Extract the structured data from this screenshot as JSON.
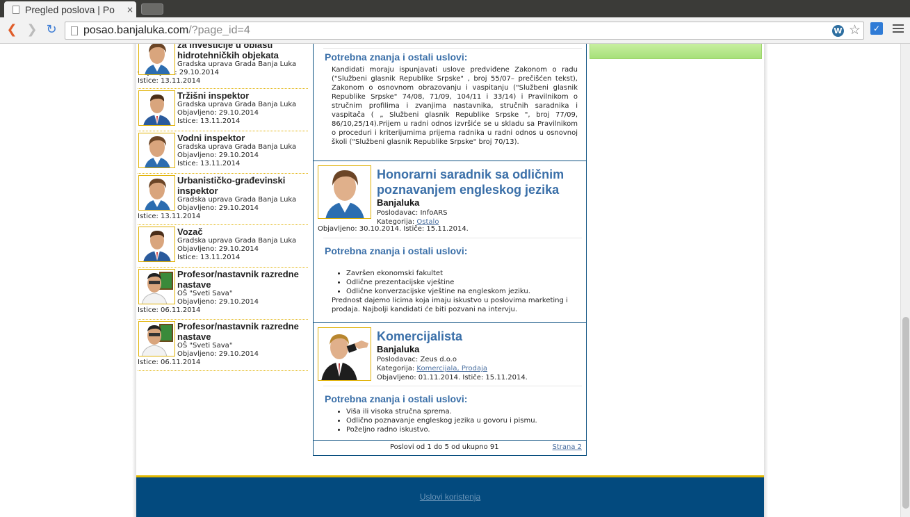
{
  "browser": {
    "tab_title": "Pregled poslova | Po",
    "tab_close": "×",
    "url_host": "posao.banjaluka.com",
    "url_path": "/?page_id=4"
  },
  "sidebar": {
    "items": [
      {
        "title": "za investicije u oblasti hidrotehničkih objekata",
        "employer": "Gradska uprava Grada Banja Luka",
        "published": "Objavljeno: 29.10.2014",
        "expires": "Istice: 13.11.2014",
        "avatar": "woman-avatar"
      },
      {
        "title": "Tržišni inspektor",
        "employer": "Gradska uprava Grada Banja Luka",
        "published": "Objavljeno: 29.10.2014",
        "expires": "Istice: 13.11.2014",
        "avatar": "man-avatar"
      },
      {
        "title": "Vodni inspektor",
        "employer": "Gradska uprava Grada Banja Luka",
        "published": "Objavljeno: 29.10.2014",
        "expires": "Istice: 13.11.2014",
        "avatar": "woman-avatar"
      },
      {
        "title": "Urbanističko-građevinski inspektor",
        "employer": "Gradska uprava Grada Banja Luka",
        "published": "Objavljeno: 29.10.2014",
        "expires": "Istice: 13.11.2014",
        "avatar": "woman-avatar"
      },
      {
        "title": "Vozač",
        "employer": "Gradska uprava Grada Banja Luka",
        "published": "Objavljeno: 29.10.2014",
        "expires": "Istice: 13.11.2014",
        "avatar": "man-avatar"
      },
      {
        "title": "Profesor/nastavnik razredne nastave",
        "employer": "OŠ \"Sveti Sava\"",
        "published": "Objavljeno: 29.10.2014",
        "expires": "Istice: 06.11.2014",
        "avatar": "teacher-avatar"
      },
      {
        "title": "Profesor/nastavnik razredne nastave",
        "employer": "OŠ \"Sveti Sava\"",
        "published": "Objavljeno: 29.10.2014",
        "expires": "Istice: 06.11.2014",
        "avatar": "teacher-avatar"
      }
    ]
  },
  "center": {
    "first_block": {
      "heading": "Potrebna znanja i ostali uslovi:",
      "text": "Kandidati moraju ispunjavati uslove predviđene Zakonom o radu (\"Službeni glasnik Republike Srpske\" , broj 55/07– prečišćen tekst), Zakonom o osnovnom obrazovanju i vaspitanju (\"Službeni glasnik Republike Srpske\" 74/08, 71/09, 104/11 i 33/14)  i Pravilnikom o stručnim profilima i zvanjima nastavnika, stručnih saradnika i vaspitača ( „ Službeni glasnik Republike Srpske \", broj 77/09, 86/10,25/14).Prijem u radni odnos izvršiće se u skladu sa Pravilnikom o proceduri i kriterijumima prijema radnika u radni odnos u osnovnoj školi (\"Službeni glasnik Republike Srpske\" broj 70/13)."
    },
    "job2": {
      "title": "Honorarni saradnik sa odličnim poznavanjem engleskog jezika",
      "city": "Banjaluka",
      "employer": "Poslodavac: InfoARS",
      "category_label": "Kategorija: ",
      "category": "Ostalo",
      "dates": "Objavljeno: 30.10.2014. Ističe: 15.11.2014.",
      "heading": "Potrebna znanja i ostali uslovi:",
      "list": [
        "Završen ekonomski fakultet",
        "Odlične prezentacijske vještine",
        "Odlične konverzacijske vještine na engleskom jeziku."
      ],
      "note": "Prednost dajemo licima koja imaju iskustvo u poslovima marketing i prodaja. Najbolji kandidati će biti pozvani na intervju."
    },
    "job3": {
      "title": "Komercijalista",
      "city": "Banjaluka",
      "employer": "Poslodavac: Zeus d.o.o",
      "category_label": "Kategorija: ",
      "category": "Komercijala, Prodaja",
      "dates": "Objavljeno: 01.11.2014. Ističe: 15.11.2014.",
      "heading": "Potrebna znanja i ostali uslovi:",
      "list": [
        "Viša ili visoka stručna sprema.",
        "Odlično poznavanje engleskog jezika u govoru i pismu.",
        "Poželjno radno iskustvo."
      ]
    },
    "pager": {
      "summary": "Poslovi od 1 do 5 od ukupno 91",
      "next": "Strana 2"
    }
  },
  "footer": {
    "link": "Uslovi koristenja"
  },
  "colors": {
    "accent_blue": "#3a6fa8",
    "footer_bg": "#034a7e",
    "gold": "#e2b800"
  }
}
